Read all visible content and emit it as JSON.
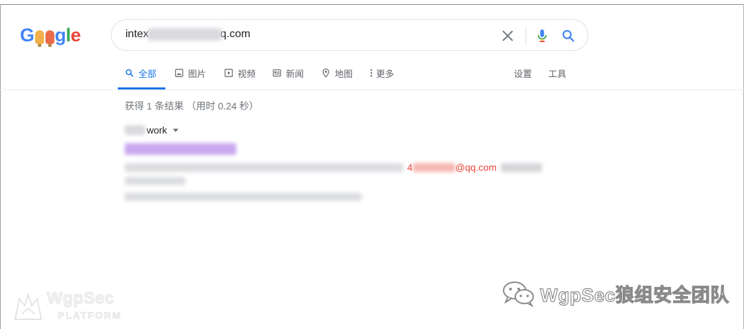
{
  "colors": {
    "accent": "#1a73e8",
    "highlight": "#ea4335",
    "text": "#202124",
    "muted": "#70757a"
  },
  "logo": {
    "letters": [
      "G",
      "o",
      "o",
      "g",
      "l",
      "e"
    ],
    "icon": "google-doodle-logo"
  },
  "search": {
    "query_start": "intex",
    "query_end": "q.com",
    "clear_icon": "close-icon",
    "mic_icon": "microphone-icon",
    "search_icon": "search-icon"
  },
  "tabs": [
    {
      "label": "全部",
      "icon": "search-icon",
      "active": true
    },
    {
      "label": "图片",
      "icon": "image-icon"
    },
    {
      "label": "视频",
      "icon": "play-icon"
    },
    {
      "label": "新闻",
      "icon": "news-icon"
    },
    {
      "label": "地图",
      "icon": "map-pin-icon"
    },
    {
      "label": "更多",
      "icon": "more-vertical-icon"
    }
  ],
  "tools": {
    "settings_label": "设置",
    "tools_label": "工具"
  },
  "stats": "获得 1 条结果 （用时 0.24 秒）",
  "result": {
    "cite_suffix": "work",
    "snippet_highlight_start": "4",
    "snippet_highlight_end": "@qq.com"
  },
  "watermarks": {
    "left_title": "WgpSec",
    "left_sub": "PLATFORM",
    "right_text": "WgpSec狼组安全团队",
    "right_icon": "wechat-icon"
  }
}
